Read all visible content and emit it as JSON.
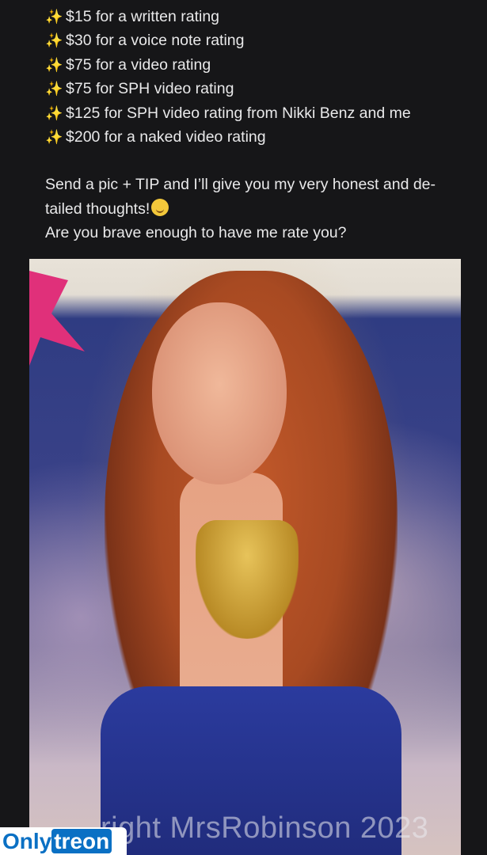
{
  "post": {
    "price_lines": [
      "$15 for a written rating",
      "$30 for a voice note rating",
      "$75 for a video rating",
      "$75 for SPH video rating",
      "$125 for SPH video rating from Nikki Benz and me",
      "$200 for a naked video rating"
    ],
    "sparkle_glyph": "✨",
    "body_line_1": "Send a pic + TIP and I’ll give you my very honest and de-",
    "body_line_2": "tailed thoughts!",
    "body_line_3": "Are you brave enough to have me rate you?"
  },
  "photo": {
    "watermark_text": "right MrsRobinson 2023"
  },
  "logo": {
    "part_1": "Only",
    "part_2": "treon"
  },
  "icons": {
    "sparkle": "sparkles-emoji",
    "smirk": "smirking-face-emoji"
  },
  "colors": {
    "background": "#161618",
    "text": "#e9e9ea",
    "logo_blue": "#0a70c4"
  }
}
